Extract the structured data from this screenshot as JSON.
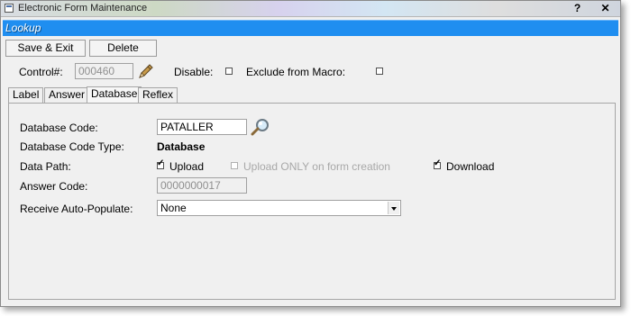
{
  "window": {
    "title": "Electronic Form Maintenance",
    "help_glyph": "?",
    "close_glyph": "✕"
  },
  "header": {
    "title": "Lookup"
  },
  "toolbar": {
    "save_exit_label": "Save & Exit",
    "delete_label": "Delete"
  },
  "control": {
    "label": "Control#:",
    "value": "000460",
    "disable_label": "Disable:",
    "disable_checked": false,
    "exclude_label": "Exclude from Macro:",
    "exclude_checked": false
  },
  "tabs": [
    {
      "label": "Label",
      "active": false
    },
    {
      "label": "Answer",
      "active": false
    },
    {
      "label": "Database",
      "active": true
    },
    {
      "label": "Reflex",
      "active": false
    }
  ],
  "database": {
    "code_label": "Database Code:",
    "code_value": "PATALLER",
    "type_label": "Database Code Type:",
    "type_value": "Database",
    "path_label": "Data Path:",
    "upload_label": "Upload",
    "upload_checked": true,
    "upload_only_label": "Upload ONLY on form creation",
    "upload_only_checked": false,
    "download_label": "Download",
    "download_checked": true,
    "answer_code_label": "Answer Code:",
    "answer_code_value": "0000000017",
    "auto_populate_label": "Receive Auto-Populate:",
    "auto_populate_value": "None"
  }
}
